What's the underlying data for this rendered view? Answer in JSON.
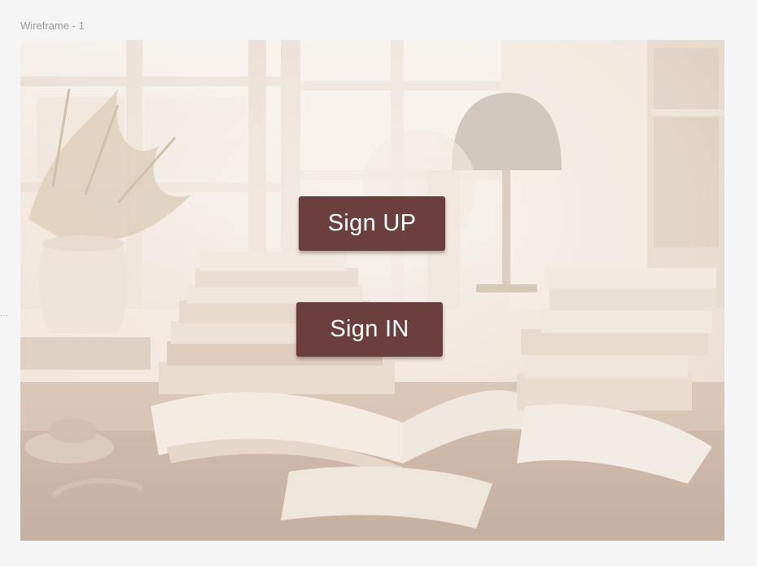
{
  "frame": {
    "label": "Wireframe - 1"
  },
  "side_marker": "...",
  "buttons": {
    "sign_up_label": "Sign UP",
    "sign_in_label": "Sign IN"
  },
  "colors": {
    "canvas_background": "#f5f5f5",
    "button_background": "#6a3f3d",
    "button_text": "#ffffff",
    "photo_tone": "#efe3d6"
  }
}
